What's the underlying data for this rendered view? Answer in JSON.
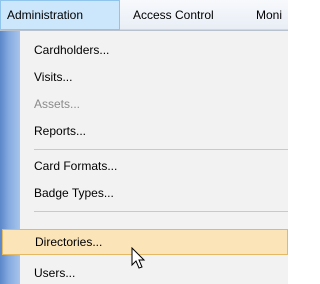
{
  "menubar": {
    "items": [
      {
        "label": "Administration",
        "active": true
      },
      {
        "label": "Access Control",
        "active": false
      },
      {
        "label": "Moni",
        "active": false
      }
    ]
  },
  "menu": {
    "items": [
      {
        "label": "Cardholders...",
        "enabled": true
      },
      {
        "label": "Visits...",
        "enabled": true
      },
      {
        "label": "Assets...",
        "enabled": false
      },
      {
        "label": "Reports...",
        "enabled": true
      },
      {
        "label": "Card Formats...",
        "enabled": true
      },
      {
        "label": "Badge Types...",
        "enabled": true
      },
      {
        "label": "Directories...",
        "enabled": true,
        "highlighted": true
      },
      {
        "label": "Users...",
        "enabled": true
      }
    ]
  },
  "colors": {
    "menubar_active": "#cce6fb",
    "highlight": "#fbe4b8",
    "highlight_border": "#e5b864",
    "gutter": "#6f9ad6",
    "disabled_text": "#8a8a8a"
  }
}
